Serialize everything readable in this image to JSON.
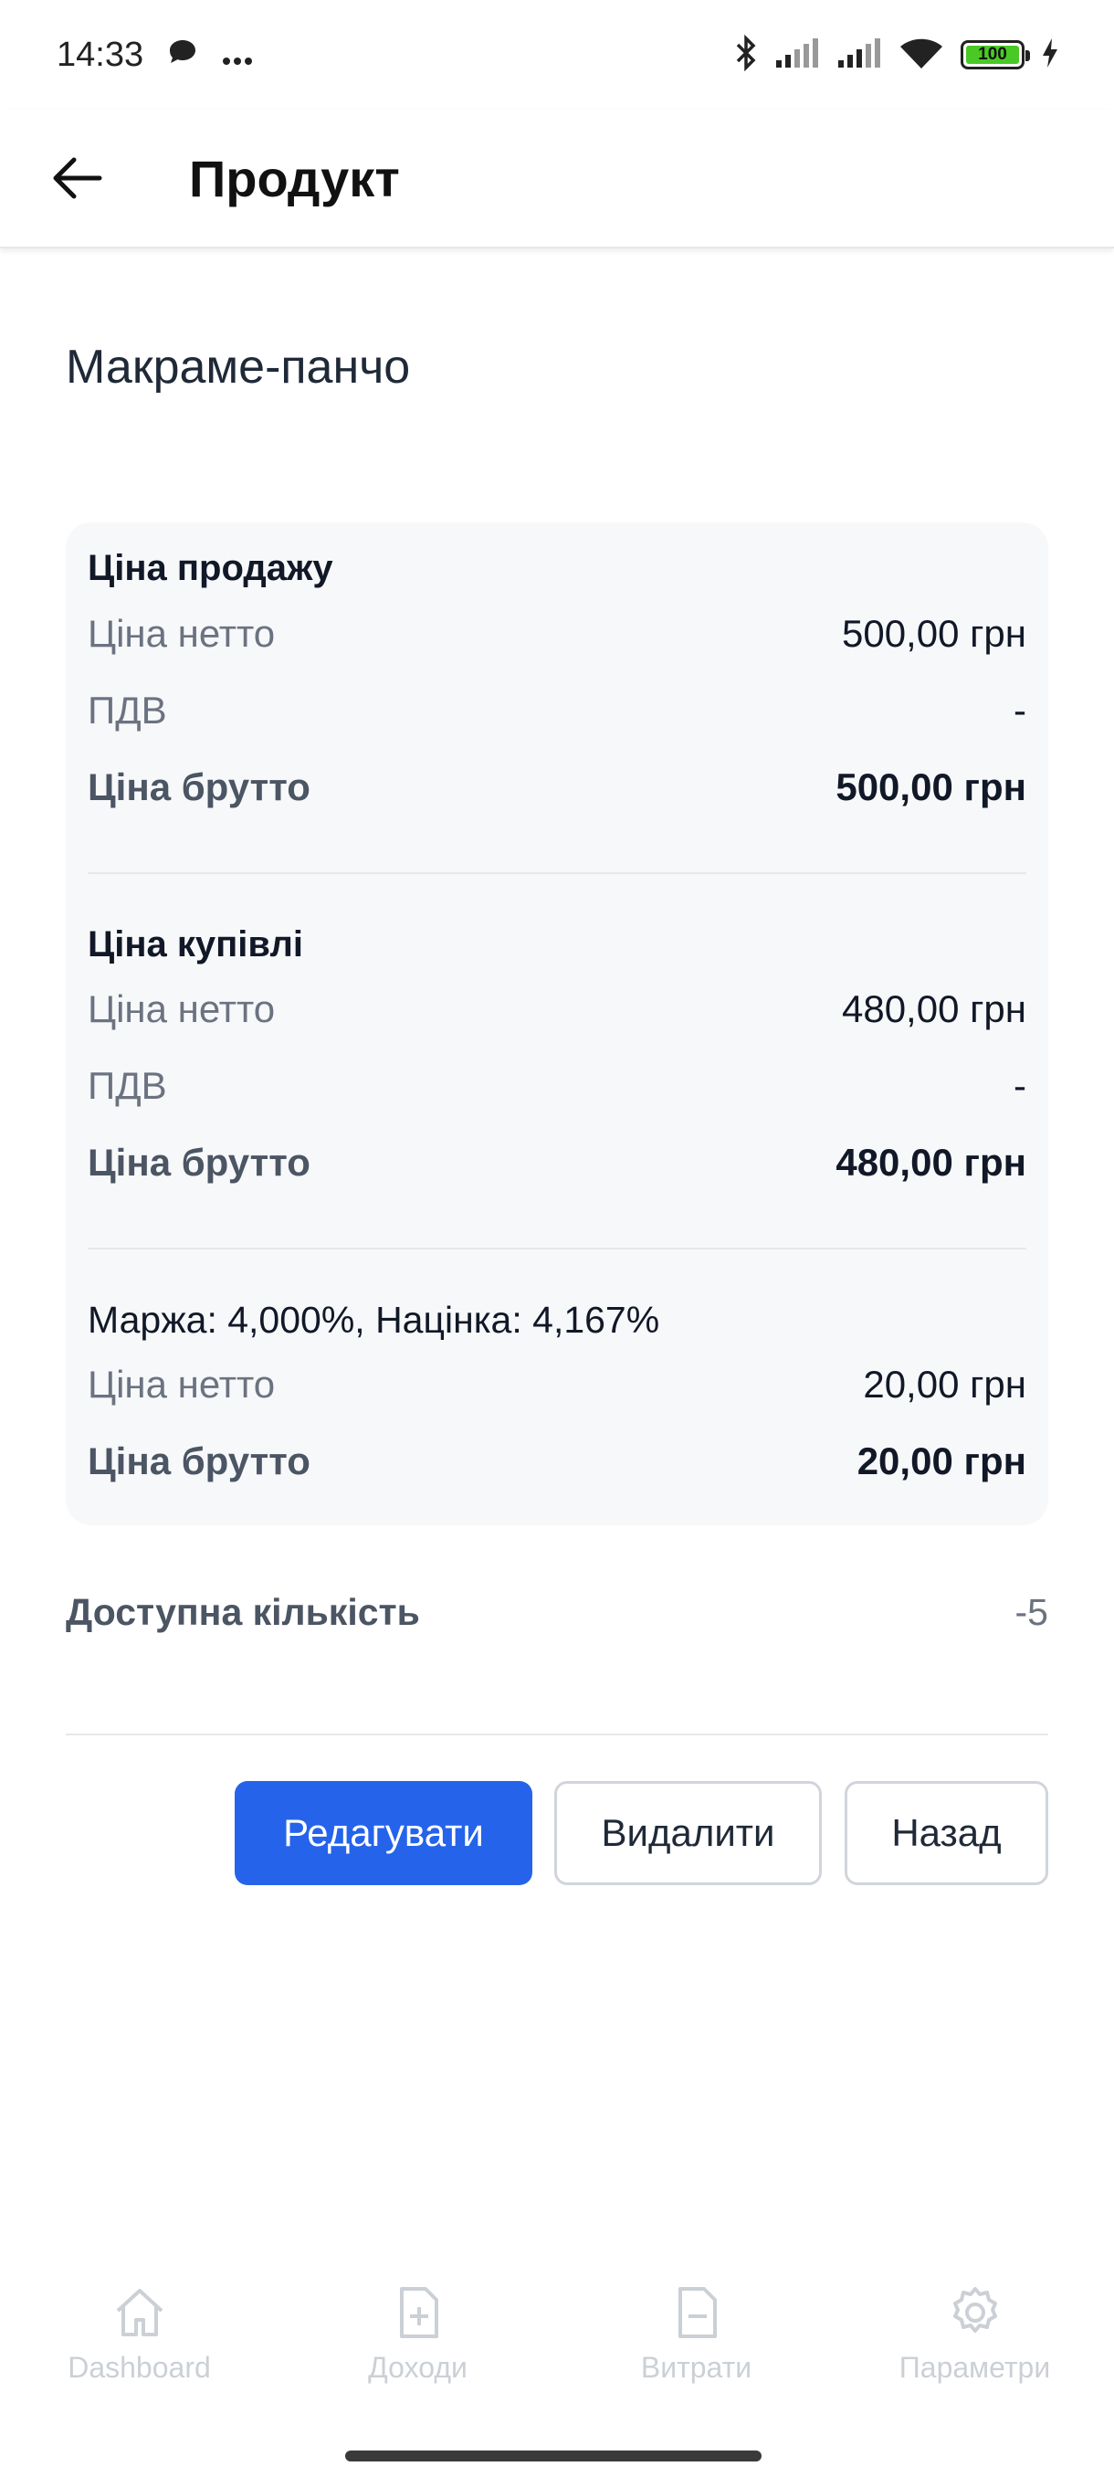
{
  "status_bar": {
    "time": "14:33",
    "battery": "100"
  },
  "app_bar": {
    "title": "Продукт"
  },
  "product": {
    "name": "Макраме-панчо"
  },
  "sale": {
    "title": "Ціна продажу",
    "net_label": "Ціна нетто",
    "net_value": "500,00 грн",
    "vat_label": "ПДВ",
    "vat_value": "-",
    "gross_label": "Ціна брутто",
    "gross_value": "500,00 грн"
  },
  "purchase": {
    "title": "Ціна купівлі",
    "net_label": "Ціна нетто",
    "net_value": "480,00 грн",
    "vat_label": "ПДВ",
    "vat_value": "-",
    "gross_label": "Ціна брутто",
    "gross_value": "480,00 грн"
  },
  "margin": {
    "summary": "Маржа: 4,000%, Націнка: 4,167%",
    "net_label": "Ціна нетто",
    "net_value": "20,00 грн",
    "gross_label": "Ціна брутто",
    "gross_value": "20,00 грн"
  },
  "quantity": {
    "label": "Доступна кількість",
    "value": "-5"
  },
  "actions": {
    "edit": "Редагувати",
    "delete": "Видалити",
    "back": "Назад"
  },
  "nav": [
    {
      "label": "Dashboard",
      "icon": "home-icon"
    },
    {
      "label": "Доходи",
      "icon": "file-plus-icon"
    },
    {
      "label": "Витрати",
      "icon": "file-minus-icon"
    },
    {
      "label": "Параметри",
      "icon": "gear-icon"
    }
  ],
  "colors": {
    "primary": "#2563eb",
    "card_bg": "#f7f8fa",
    "nav_inactive": "#cbd0d6"
  }
}
